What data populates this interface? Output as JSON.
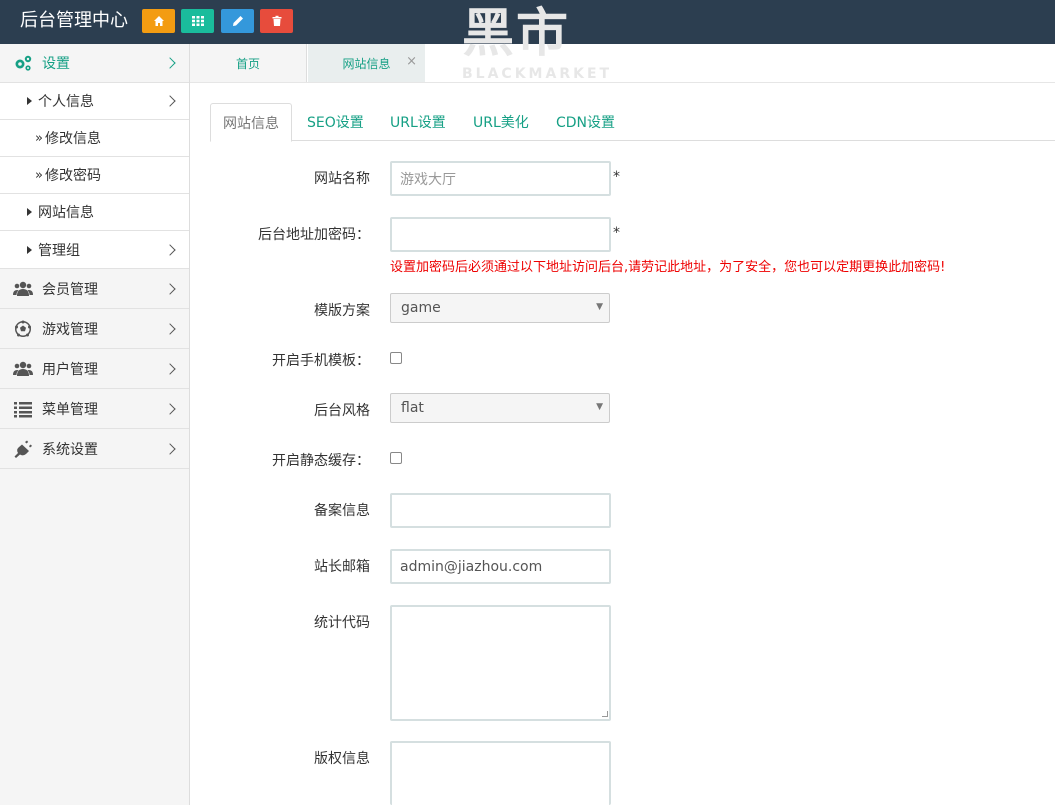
{
  "app": {
    "title": "后台管理中心",
    "toolbar": [
      {
        "icon": "home-icon",
        "color": "#f39c12"
      },
      {
        "icon": "grid-icon",
        "color": "#1abc9c"
      },
      {
        "icon": "pencil-icon",
        "color": "#3498db"
      },
      {
        "icon": "trash-icon",
        "color": "#e74c3c"
      }
    ]
  },
  "sidebar": {
    "settings": "设置",
    "personal": "个人信息",
    "edit_info": "修改信息",
    "change_pwd": "修改密码",
    "site_info": "网站信息",
    "admin_group": "管理组",
    "members": "会员管理",
    "games": "游戏管理",
    "users": "用户管理",
    "menus": "菜单管理",
    "system": "系统设置",
    "raquo": "»"
  },
  "page_tabs": {
    "home": "首页",
    "current": "网站信息",
    "close": "×"
  },
  "watermark": {
    "cn": "黑市",
    "en": "BLACKMARKET"
  },
  "content_tabs": [
    "网站信息",
    "SEO设置",
    "URL设置",
    "URL美化",
    "CDN设置"
  ],
  "form": {
    "site_name": {
      "label": "网站名称",
      "placeholder": "游戏大厅"
    },
    "admin_key": {
      "label": "后台地址加密码：",
      "value": ""
    },
    "required_mark": "*",
    "admin_key_hint": "设置加密码后必须通过以下地址访问后台,请劳记此地址，为了安全，您也可以定期更换此加密码!",
    "template": {
      "label": "模版方案",
      "value": "game"
    },
    "mobile_template": {
      "label": "开启手机模板：",
      "checked": false
    },
    "admin_style": {
      "label": "后台风格",
      "value": "flat"
    },
    "static_cache": {
      "label": "开启静态缓存：",
      "checked": false
    },
    "icp": {
      "label": "备案信息",
      "value": ""
    },
    "email": {
      "label": "站长邮箱",
      "value": "admin@jiazhou.com"
    },
    "stats_code": {
      "label": "统计代码",
      "value": ""
    },
    "copyright": {
      "label": "版权信息",
      "value": ""
    }
  },
  "colors": {
    "topbar": "#2c3e50",
    "accent": "#16a085",
    "error": "#e00000"
  }
}
